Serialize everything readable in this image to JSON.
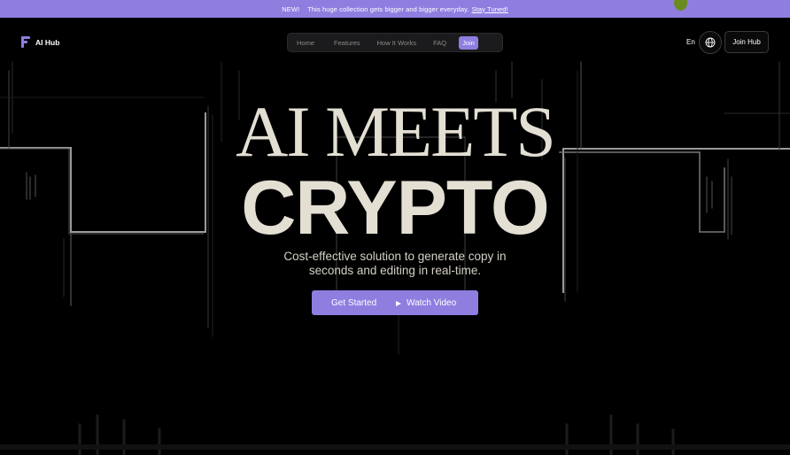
{
  "announcement": {
    "badge": "NEW!",
    "message": "This huge collection gets bigger and bigger everyday.",
    "link": "Stay Tuned!"
  },
  "header": {
    "logo_text": "AI Hub",
    "nav": [
      "Home",
      "Features",
      "How It Works",
      "FAQ"
    ],
    "nav_join": "Join",
    "language": "En",
    "join_hub": "Join Hub"
  },
  "hero": {
    "title_line1": "AI MEETS",
    "title_line2": "CRYPTO",
    "subtitle_line1": "Cost-effective solution to generate copy in",
    "subtitle_line2": "seconds and editing in real-time.",
    "primary_cta": "Get Started",
    "secondary_cta": "Watch Video"
  },
  "colors": {
    "accent": "#8f7ee0",
    "background": "#000000",
    "text": "#e3dfd3"
  }
}
